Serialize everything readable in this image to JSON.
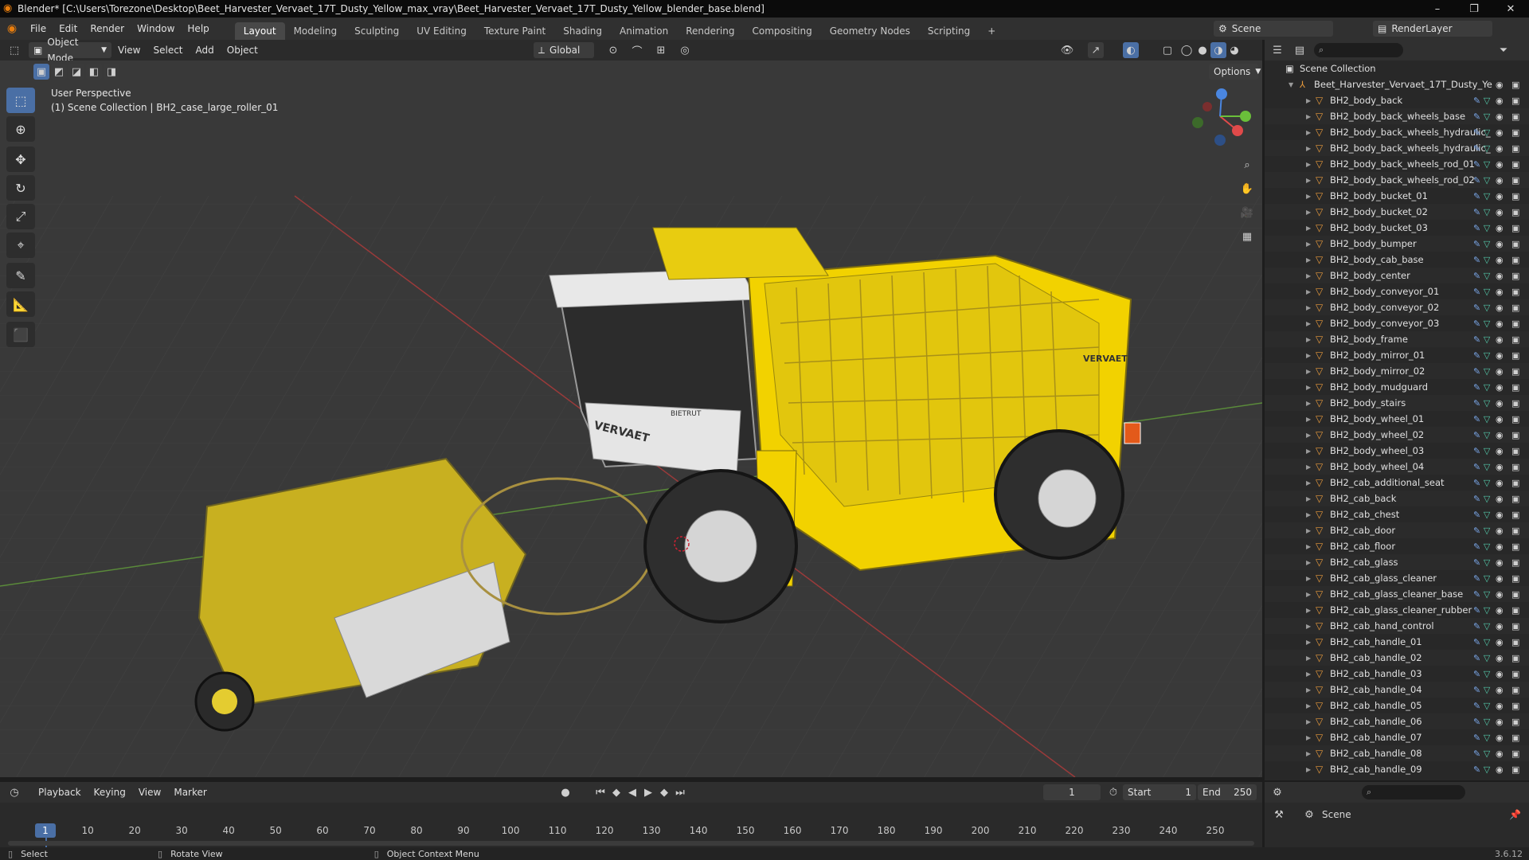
{
  "window": {
    "title": "Blender* [C:\\Users\\Torezone\\Desktop\\Beet_Harvester_Vervaet_17T_Dusty_Yellow_max_vray\\Beet_Harvester_Vervaet_17T_Dusty_Yellow_blender_base.blend]",
    "min": "–",
    "max": "❐",
    "close": "✕"
  },
  "menubar": {
    "items": [
      "File",
      "Edit",
      "Render",
      "Window",
      "Help"
    ],
    "workspaces": [
      "Layout",
      "Modeling",
      "Sculpting",
      "UV Editing",
      "Texture Paint",
      "Shading",
      "Animation",
      "Rendering",
      "Compositing",
      "Geometry Nodes",
      "Scripting"
    ],
    "add_tab": "+",
    "scene_label": "Scene",
    "view_layer_label": "RenderLayer"
  },
  "viewport_header": {
    "mode": "Object Mode",
    "menus": [
      "View",
      "Select",
      "Add",
      "Object"
    ],
    "orientation": "Global",
    "options": "Options"
  },
  "viewport": {
    "perspective": "User Perspective",
    "collection_info": "(1) Scene Collection | BH2_case_large_roller_01",
    "decal_brand": "VERVAET",
    "decal_brand2": "VERVAET",
    "decal_plate": "BIETRUT"
  },
  "outliner": {
    "root": "Scene Collection",
    "collection": "Beet_Harvester_Vervaet_17T_Dusty_Ye",
    "items": [
      "BH2_body_back",
      "BH2_body_back_wheels_base",
      "BH2_body_back_wheels_hydraulic_",
      "BH2_body_back_wheels_hydraulic_",
      "BH2_body_back_wheels_rod_01",
      "BH2_body_back_wheels_rod_02",
      "BH2_body_bucket_01",
      "BH2_body_bucket_02",
      "BH2_body_bucket_03",
      "BH2_body_bumper",
      "BH2_body_cab_base",
      "BH2_body_center",
      "BH2_body_conveyor_01",
      "BH2_body_conveyor_02",
      "BH2_body_conveyor_03",
      "BH2_body_frame",
      "BH2_body_mirror_01",
      "BH2_body_mirror_02",
      "BH2_body_mudguard",
      "BH2_body_stairs",
      "BH2_body_wheel_01",
      "BH2_body_wheel_02",
      "BH2_body_wheel_03",
      "BH2_body_wheel_04",
      "BH2_cab_additional_seat",
      "BH2_cab_back",
      "BH2_cab_chest",
      "BH2_cab_door",
      "BH2_cab_floor",
      "BH2_cab_glass",
      "BH2_cab_glass_cleaner",
      "BH2_cab_glass_cleaner_base",
      "BH2_cab_glass_cleaner_rubber",
      "BH2_cab_hand_control",
      "BH2_cab_handle_01",
      "BH2_cab_handle_02",
      "BH2_cab_handle_03",
      "BH2_cab_handle_04",
      "BH2_cab_handle_05",
      "BH2_cab_handle_06",
      "BH2_cab_handle_07",
      "BH2_cab_handle_08",
      "BH2_cab_handle_09"
    ]
  },
  "timeline": {
    "menus": [
      "Playback",
      "Keying",
      "View",
      "Marker"
    ],
    "current_frame": "1",
    "start_label": "Start",
    "start_value": "1",
    "end_label": "End",
    "end_value": "250",
    "ticks": [
      "1",
      "10",
      "20",
      "30",
      "40",
      "50",
      "60",
      "70",
      "80",
      "90",
      "100",
      "110",
      "120",
      "130",
      "140",
      "150",
      "160",
      "170",
      "180",
      "190",
      "200",
      "210",
      "220",
      "230",
      "240",
      "250"
    ]
  },
  "properties": {
    "scene_label": "Scene"
  },
  "statusbar": {
    "select": "Select",
    "rotate": "Rotate View",
    "context": "Object Context Menu",
    "version": "3.6.12"
  },
  "colors": {
    "accent": "#4a6fa5",
    "machine_yellow": "#f2d200",
    "outliner_object": "#e89a3c"
  }
}
